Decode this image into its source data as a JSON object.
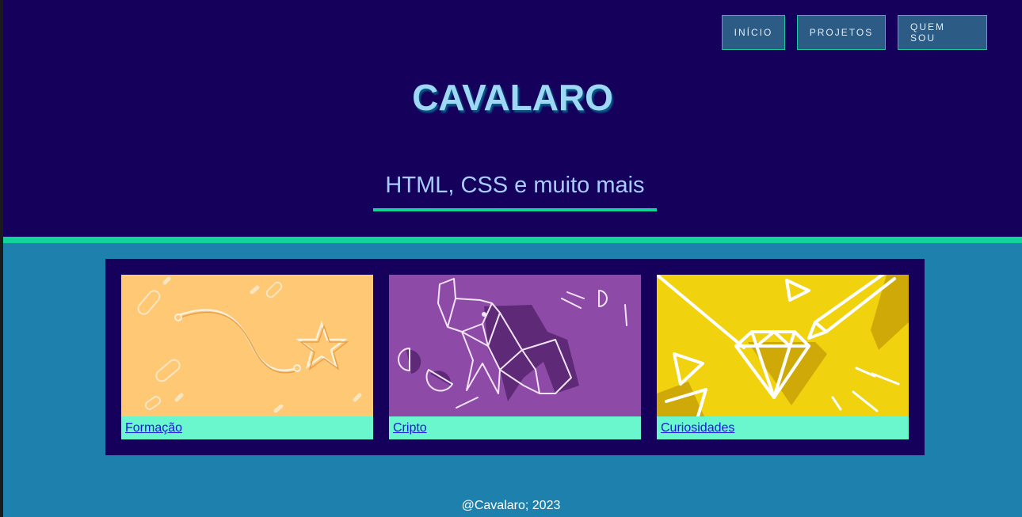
{
  "nav": {
    "items": [
      {
        "label": "INÍCIO"
      },
      {
        "label": "PROJETOS"
      },
      {
        "label": "QUEM SOU"
      }
    ]
  },
  "header": {
    "title": "CAVALARO",
    "subtitle": "HTML, CSS e muito mais"
  },
  "cards": [
    {
      "label": "Formação",
      "image_icon": "star-path-illustration",
      "color": "#ffc875"
    },
    {
      "label": "Cripto",
      "image_icon": "origami-elephant-illustration",
      "color": "#8e4aa7"
    },
    {
      "label": "Curiosidades",
      "image_icon": "diamond-pencil-illustration",
      "color": "#f0d20e"
    }
  ],
  "footer": {
    "text": "@Cavalaro; 2023"
  },
  "colors": {
    "header_bg": "#15005c",
    "accent": "#12d49b",
    "page_bg": "#1e81ad",
    "title": "#9fd8f5"
  }
}
